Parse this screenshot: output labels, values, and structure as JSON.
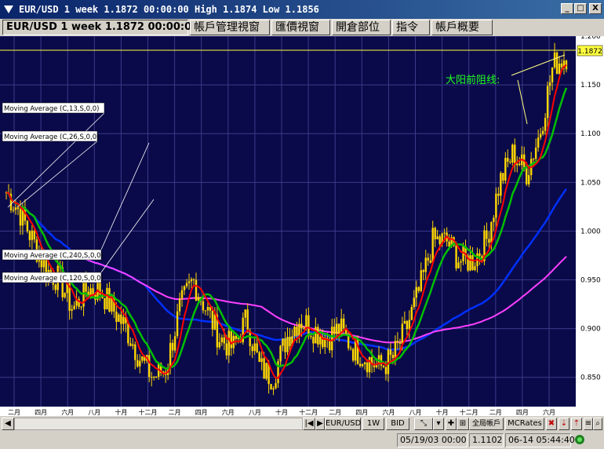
{
  "window": {
    "title": "EUR/USD 1 week 1.1872 00:00:00 High 1.1874 Low 1.1856",
    "controls": [
      "_",
      "□",
      "X"
    ]
  },
  "tabs": [
    {
      "label": "EUR/USD 1 week 1.1872 00:00:00",
      "active": true
    },
    {
      "label": "帳戶管理視窗"
    },
    {
      "label": "匯價視窗"
    },
    {
      "label": "開倉部位"
    },
    {
      "label": "指令"
    },
    {
      "label": "帳戶概要"
    }
  ],
  "chart": {
    "current_price_label": "1.1872",
    "annotation": "大阳前阻线:",
    "indicators": [
      {
        "label": "Moving Average (C,13,S,0,0)",
        "color": "#ff0000"
      },
      {
        "label": "Moving Average (C,26,S,0,0)",
        "color": "#00c000"
      },
      {
        "label": "Moving Average (C,240,S,0,0)",
        "color": "#ff40ff"
      },
      {
        "label": "Moving Average (C,120,S,0,0)",
        "color": "#0030ff"
      }
    ],
    "colors": {
      "background": "#0a0a4a",
      "grid": "#3a3a8a",
      "candle": "#ffd700",
      "price_line": "#ffff40"
    }
  },
  "chart_data": {
    "type": "candlestick",
    "symbol": "EUR/USD",
    "timeframe": "1 week",
    "ylim": [
      0.82,
      1.2
    ],
    "y_ticks": [
      "0.850",
      "0.900",
      "0.950",
      "1.000",
      "1.050",
      "1.100",
      "1.150",
      "1.200"
    ],
    "x_ticks": [
      "二月",
      "四月",
      "六月",
      "八月",
      "十月",
      "十二月",
      "二月",
      "四月",
      "六月",
      "八月",
      "十月",
      "十二月",
      "二月",
      "四月",
      "六月",
      "八月",
      "十月",
      "十二月",
      "二月",
      "四月",
      "六月"
    ],
    "close_approx": [
      1.04,
      1.02,
      0.99,
      0.96,
      0.95,
      0.92,
      0.94,
      0.94,
      0.92,
      0.9,
      0.87,
      0.85,
      0.86,
      0.92,
      0.95,
      0.92,
      0.89,
      0.88,
      0.91,
      0.86,
      0.85,
      0.89,
      0.91,
      0.9,
      0.89,
      0.9,
      0.88,
      0.87,
      0.86,
      0.87,
      0.9,
      0.94,
      0.99,
      0.99,
      0.97,
      0.97,
      0.99,
      1.05,
      1.08,
      1.06,
      1.1,
      1.17,
      1.18
    ]
  },
  "toolbar": {
    "symbol": "EUR/USD",
    "timeframe": "1W",
    "price_type": "BID",
    "global_account": "全局帳戶",
    "mcrates": "MCRates"
  },
  "status": {
    "datetime": "05/19/03 00:00",
    "price": "1.1102",
    "time": "06-14 05:44:40"
  }
}
